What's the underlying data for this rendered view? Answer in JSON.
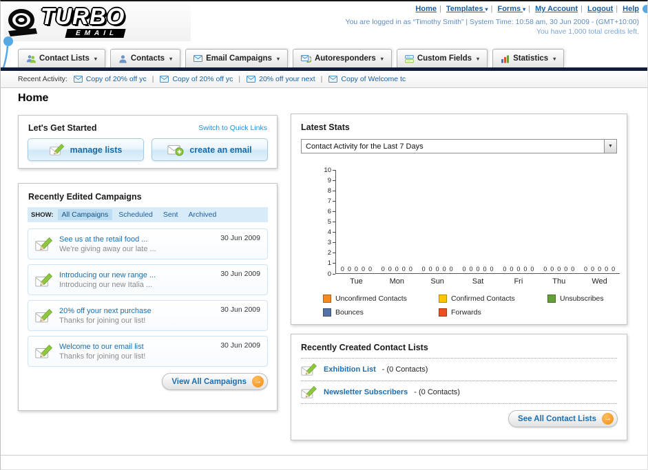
{
  "header": {
    "logo_main": "TURBO",
    "logo_sub": "EMAIL",
    "links": [
      {
        "label": "Home"
      },
      {
        "label": "Templates"
      },
      {
        "label": "Forms"
      },
      {
        "label": "My Account"
      },
      {
        "label": "Logout"
      },
      {
        "label": "Help"
      }
    ],
    "login_info": "You are logged in as “Timothy Smith” | System Time: 10:58 am, 30 Jun 2009 - (GMT+10:00)",
    "credits_info": "You have 1,000 total credits left."
  },
  "nav": {
    "tabs": [
      {
        "label": "Contact Lists"
      },
      {
        "label": "Contacts"
      },
      {
        "label": "Email Campaigns"
      },
      {
        "label": "Autoresponders"
      },
      {
        "label": "Custom Fields"
      },
      {
        "label": "Statistics"
      }
    ]
  },
  "recent_activity": {
    "label": "Recent Activity:",
    "items": [
      {
        "text": "Copy of 20% off yc"
      },
      {
        "text": "Copy of 20% off yc"
      },
      {
        "text": "20% off your next"
      },
      {
        "text": "Copy of Welcome tc"
      }
    ]
  },
  "page_title": "Home",
  "get_started": {
    "title": "Let's Get Started",
    "switch_link": "Switch to Quick Links",
    "manage_lists_label": "manage lists",
    "create_email_label": "create an email"
  },
  "campaigns": {
    "title": "Recently Edited Campaigns",
    "show_label": "SHOW:",
    "filters": [
      {
        "label": "All Campaigns"
      },
      {
        "label": "Scheduled"
      },
      {
        "label": "Sent"
      },
      {
        "label": "Archived"
      }
    ],
    "items": [
      {
        "title": "See us at the retail food ...",
        "subtitle": "We're giving away our late ...",
        "date": "30 Jun 2009"
      },
      {
        "title": "Introducing our new range ...",
        "subtitle": "Introducing our new Italia ...",
        "date": "30 Jun 2009"
      },
      {
        "title": "20% off your next purchase",
        "subtitle": "Thanks for joining our list!",
        "date": "30 Jun 2009"
      },
      {
        "title": "Welcome to our email list",
        "subtitle": "Thanks for joining our list!",
        "date": "30 Jun 2009"
      }
    ],
    "view_all_label": "View All Campaigns"
  },
  "stats": {
    "title": "Latest Stats",
    "period_selected": "Contact Activity for the Last 7 Days",
    "chart_data": {
      "type": "bar",
      "title": "Contact Activity for the Last 7 Days",
      "categories": [
        "Tue",
        "Mon",
        "Sun",
        "Sat",
        "Fri",
        "Thu",
        "Wed"
      ],
      "series": [
        {
          "name": "Unconfirmed Contacts",
          "color": "#f6891f",
          "values": [
            0,
            0,
            0,
            0,
            0,
            0,
            0
          ]
        },
        {
          "name": "Confirmed Contacts",
          "color": "#fdc600",
          "values": [
            0,
            0,
            0,
            0,
            0,
            0,
            0
          ]
        },
        {
          "name": "Unsubscribes",
          "color": "#64a036",
          "values": [
            0,
            0,
            0,
            0,
            0,
            0,
            0
          ]
        },
        {
          "name": "Bounces",
          "color": "#5572a8",
          "values": [
            0,
            0,
            0,
            0,
            0,
            0,
            0
          ]
        },
        {
          "name": "Forwards",
          "color": "#e8501f",
          "values": [
            0,
            0,
            0,
            0,
            0,
            0,
            0
          ]
        }
      ],
      "ylim": [
        0,
        10
      ],
      "yticks": [
        0,
        1,
        2,
        3,
        4,
        5,
        6,
        7,
        8,
        9,
        10
      ],
      "grid": false,
      "value_labels": true,
      "legend_position": "bottom"
    }
  },
  "contact_lists": {
    "title": "Recently Created Contact Lists",
    "items": [
      {
        "name": "Exhibition List",
        "detail": "- (0 Contacts)"
      },
      {
        "name": "Newsletter Subscribers",
        "detail": "- (0 Contacts)"
      }
    ],
    "see_all_label": "See All Contact Lists"
  }
}
